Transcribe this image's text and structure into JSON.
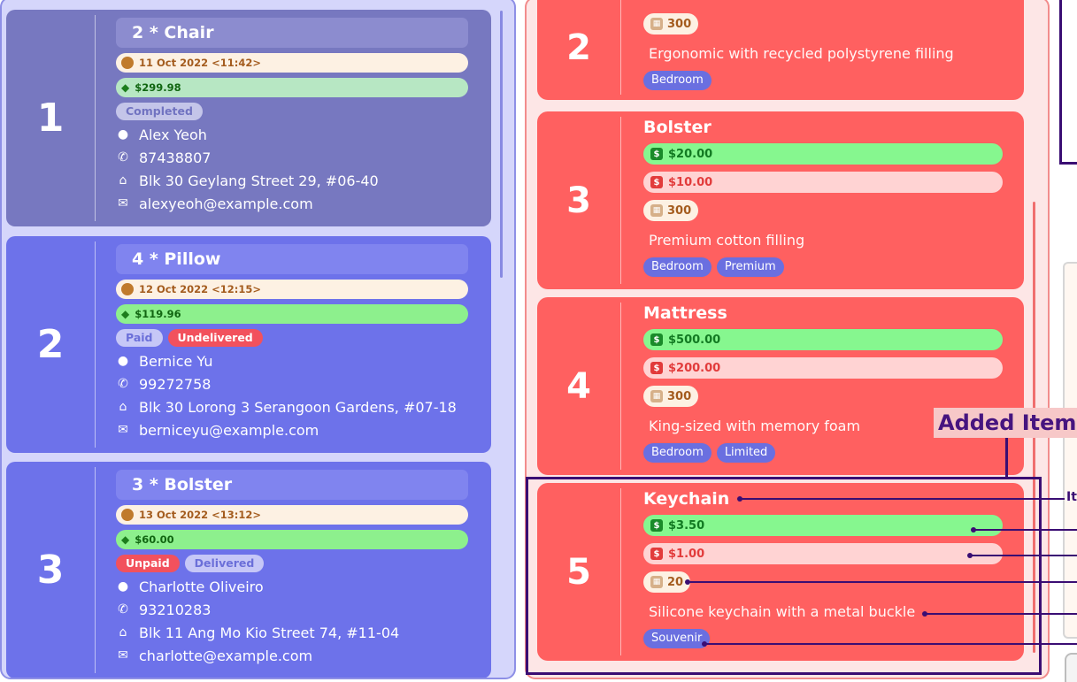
{
  "orders": [
    {
      "index": "1",
      "title": "2 * Chair",
      "date": "11 Oct 2022 <11:42>",
      "price": "$299.98",
      "badges": [
        "Completed"
      ],
      "name": "Alex Yeoh",
      "phone": "87438807",
      "address": "Blk 30 Geylang Street 29, #06-40",
      "email": "alexyeoh@example.com"
    },
    {
      "index": "2",
      "title": "4 * Pillow",
      "date": "12 Oct 2022 <12:15>",
      "price": "$119.96",
      "badges": [
        "Paid",
        "Undelivered"
      ],
      "name": "Bernice Yu",
      "phone": "99272758",
      "address": "Blk 30 Lorong 3 Serangoon Gardens, #07-18",
      "email": "berniceyu@example.com"
    },
    {
      "index": "3",
      "title": "3 * Bolster",
      "date": "13 Oct 2022 <13:12>",
      "price": "$60.00",
      "badges": [
        "Unpaid",
        "Delivered"
      ],
      "name": "Charlotte Oliveiro",
      "phone": "93210283",
      "address": "Blk 11 Ang Mo Kio Street 74, #11-04",
      "email": "charlotte@example.com"
    }
  ],
  "items": [
    {
      "index": "2",
      "quantity": "300",
      "description": "Ergonomic with recycled polystyrene filling",
      "tags": [
        "Bedroom"
      ]
    },
    {
      "index": "3",
      "title": "Bolster",
      "sell_price": "$20.00",
      "cost_price": "$10.00",
      "quantity": "300",
      "description": "Premium cotton filling",
      "tags": [
        "Bedroom",
        "Premium"
      ]
    },
    {
      "index": "4",
      "title": "Mattress",
      "sell_price": "$500.00",
      "cost_price": "$200.00",
      "quantity": "300",
      "description": "King-sized with memory foam",
      "tags": [
        "Bedroom",
        "Limited"
      ]
    },
    {
      "index": "5",
      "title": "Keychain",
      "sell_price": "$3.50",
      "cost_price": "$1.00",
      "quantity": "20",
      "description": "Silicone keychain with a metal buckle",
      "tags": [
        "Souvenir"
      ]
    }
  ],
  "annotation": {
    "label": "Added Item",
    "tip_fragment": "It"
  },
  "icons": {
    "clock": "clock-icon",
    "price_tag": "price-tag-icon",
    "person": "person-icon",
    "phone": "phone-icon",
    "home": "home-icon",
    "email": "email-icon",
    "sell": "sell-price-icon",
    "cost": "cost-price-icon",
    "quantity": "quantity-icon"
  },
  "colors": {
    "order_panel_bg": "#d5d6fb",
    "order_card_active": "#6d72ea",
    "order_card_completed": "#7778c0",
    "item_panel_bg": "#fde6e6",
    "item_card": "#ff6060",
    "annotation": "#3a0d73"
  }
}
